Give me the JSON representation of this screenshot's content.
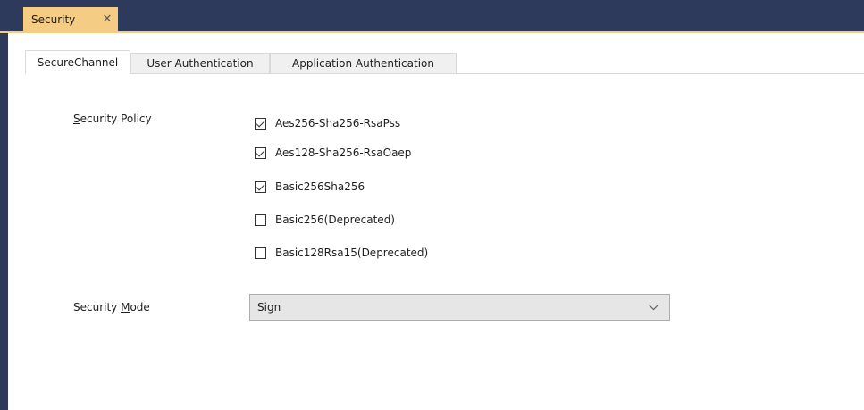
{
  "document_tab": {
    "title": "Security",
    "close_glyph": "✕"
  },
  "tabs": [
    {
      "label": "SecureChannel",
      "active": true
    },
    {
      "label": "User Authentication",
      "active": false
    },
    {
      "label": "Application Authentication",
      "active": false
    }
  ],
  "security_policy": {
    "label_access_key": "S",
    "label_rest": "ecurity Policy",
    "options": [
      {
        "label": "Aes256-Sha256-RsaPss",
        "checked": true
      },
      {
        "label": "Aes128-Sha256-RsaOaep",
        "checked": true
      },
      {
        "label": "Basic256Sha256",
        "checked": true
      },
      {
        "label": "Basic256(Deprecated)",
        "checked": false
      },
      {
        "label": "Basic128Rsa15(Deprecated)",
        "checked": false
      }
    ]
  },
  "security_mode": {
    "label_before": "Security ",
    "label_access_key": "M",
    "label_after": "ode",
    "value": "Sign",
    "arrow_icon": "chevron-down-icon"
  },
  "colors": {
    "tabbar_bg": "#2d3a5c",
    "active_doc_tab": "#f5cc84",
    "panel_bg": "#ffffff"
  }
}
